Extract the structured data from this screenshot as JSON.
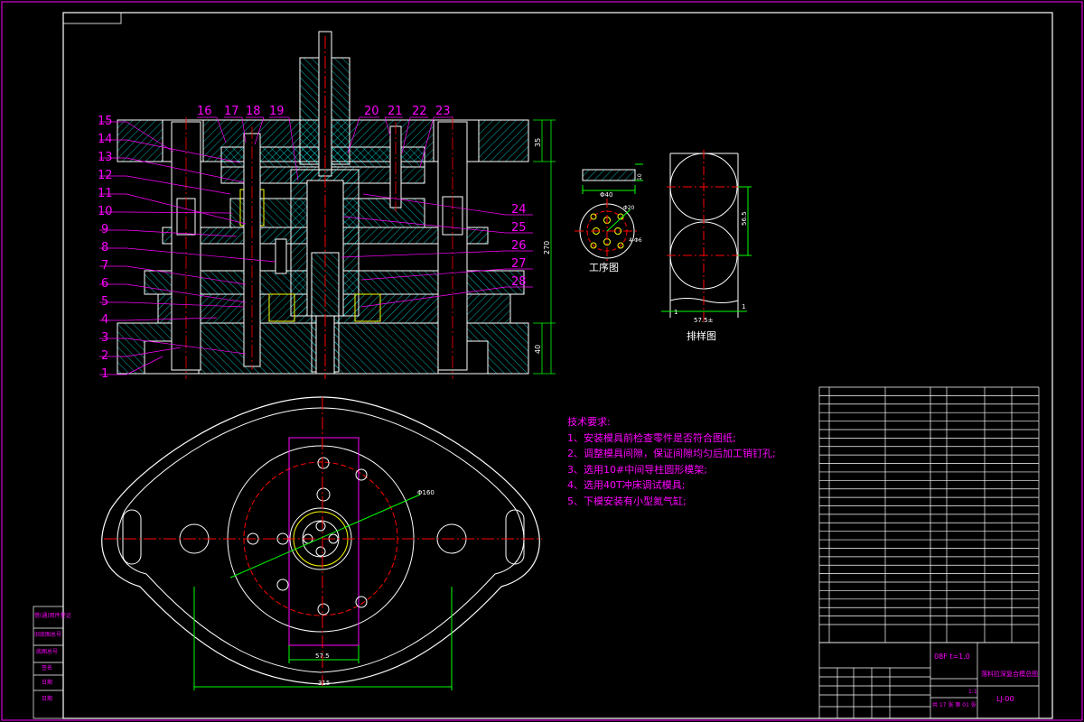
{
  "drawing": {
    "part_numbers": [
      "1",
      "2",
      "3",
      "4",
      "5",
      "6",
      "7",
      "8",
      "9",
      "10",
      "11",
      "12",
      "13",
      "14",
      "15",
      "16",
      "17",
      "18",
      "19",
      "20",
      "21",
      "22",
      "23",
      "24",
      "25",
      "26",
      "27",
      "28"
    ],
    "dimensions": {
      "top_h": "35",
      "total_h": "270",
      "bottom_h": "40",
      "blank_dia": "Φ40",
      "hole_dia": "Φ20",
      "hole_count": "4-Φ6",
      "bolt_circle": "Φ160",
      "plate_w": "57.5",
      "total_w": "315",
      "strip_w": "57.5±",
      "strip_pitch": "56.5",
      "blank_side": "1",
      "blank_h": "10",
      "edge_mark": "1"
    },
    "views": {
      "process_title": "工序图",
      "layout_title": "排样图"
    },
    "tech_title": "技术要求:",
    "tech_notes": [
      "1、安装模具前检查零件是否符合图纸;",
      "2、调整模具间隙，保证间隙均匀后加工销钉孔;",
      "3、选用10#中间导柱圆形模架;",
      "4、选用40T冲床调试模具;",
      "5、下模安装有小型氮气缸;"
    ],
    "title_block": {
      "material": "08F t=1.0",
      "name": "落料拉深复合模总图",
      "code": "LJ-00",
      "scale": "1:1",
      "sheet": "共 17 张  第 01 张"
    },
    "side_labels": [
      "借(通)用件登记",
      "旧底图总号",
      "底图总号",
      "签名",
      "日期",
      "日期"
    ],
    "colors": {
      "line": "#ff00ff",
      "white": "#ffffff",
      "red": "#ff0000",
      "green": "#00ff00",
      "cyan": "#00ffff",
      "yellow": "#ffff00"
    }
  }
}
